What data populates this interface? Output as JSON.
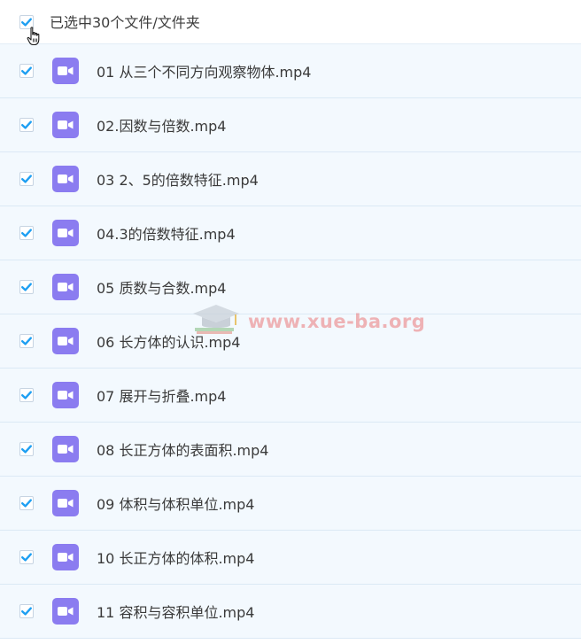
{
  "header": {
    "selection_label": "已选中30个文件/文件夹",
    "checked": true
  },
  "files": [
    {
      "name": "01 从三个不同方向观察物体.mp4",
      "checked": true,
      "icon": "video-icon"
    },
    {
      "name": "02.因数与倍数.mp4",
      "checked": true,
      "icon": "video-icon"
    },
    {
      "name": "03 2、5的倍数特征.mp4",
      "checked": true,
      "icon": "video-icon"
    },
    {
      "name": "04.3的倍数特征.mp4",
      "checked": true,
      "icon": "video-icon"
    },
    {
      "name": "05 质数与合数.mp4",
      "checked": true,
      "icon": "video-icon"
    },
    {
      "name": "06 长方体的认识.mp4",
      "checked": true,
      "icon": "video-icon"
    },
    {
      "name": "07 展开与折叠.mp4",
      "checked": true,
      "icon": "video-icon"
    },
    {
      "name": "08 长正方体的表面积.mp4",
      "checked": true,
      "icon": "video-icon"
    },
    {
      "name": "09 体积与体积单位.mp4",
      "checked": true,
      "icon": "video-icon"
    },
    {
      "name": "10 长正方体的体积.mp4",
      "checked": true,
      "icon": "video-icon"
    },
    {
      "name": "11 容积与容积单位.mp4",
      "checked": true,
      "icon": "video-icon"
    }
  ],
  "watermark": {
    "text": "www.xue-ba.org"
  },
  "colors": {
    "check": "#1e9ff2",
    "video_icon_bg": "#8b7cf0",
    "row_bg": "#f3f9fe",
    "row_border": "#dbe9f5"
  }
}
